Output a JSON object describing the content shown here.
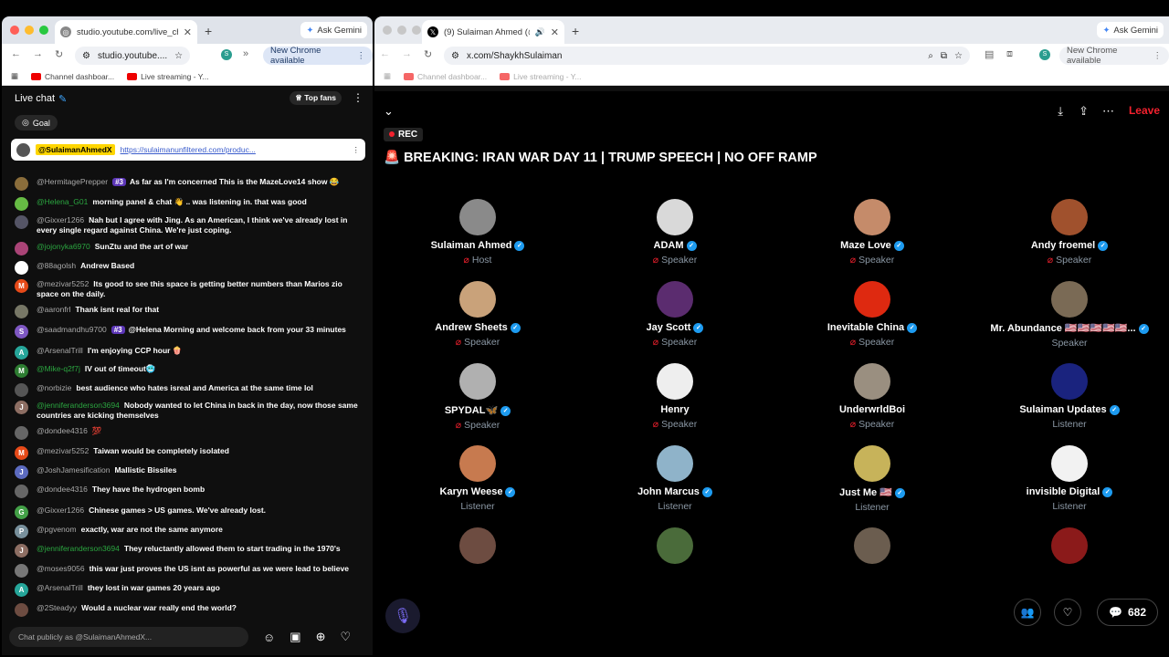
{
  "left_browser": {
    "tab_title": "studio.youtube.com/live_chat",
    "ask_gemini": "Ask Gemini",
    "url": "studio.youtube....",
    "new_chrome": "New Chrome available",
    "bookmarks": [
      "Channel dashboar...",
      "Live streaming - Y..."
    ]
  },
  "chat": {
    "title": "Live chat",
    "top_fans": "Top fans",
    "goal": "Goal",
    "pinned": {
      "author": "@SulaimanAhmedX",
      "link": "https://sulaimanunfiltered.com/produc..."
    },
    "messages": [
      {
        "author": "@HermitagePrepper",
        "badge": "#3",
        "text": "As far as I'm concerned This is the MazeLove14 show 😂",
        "color": "#8a6d3b"
      },
      {
        "author": "@Helena_G01",
        "text": "morning panel & chat 👋 .. was listening in. that was good",
        "color": "#6b4",
        "green": true
      },
      {
        "author": "@Gixxer1266",
        "text": "Nah but I agree with Jing. As an American, I think we've already lost in every single regard against China. We're just coping.",
        "color": "#556"
      },
      {
        "author": "@jojonyka6970",
        "text": "SunZtu and the art of war",
        "color": "#a47",
        "green": true
      },
      {
        "author": "@88agolsh",
        "text": "Andrew Based",
        "color": "#fff"
      },
      {
        "author": "@mezivar5252",
        "text": "Its good to see this space is getting better numbers than Marios zio space on the daily.",
        "color": "#e64a19",
        "initial": "M"
      },
      {
        "author": "@aaronfrl",
        "text": "Thank isnt real for that",
        "color": "#776"
      },
      {
        "author": "@saadmandhu9700",
        "badge": "#3",
        "text": "@Helena Morning and welcome back from your 33 minutes",
        "color": "#7e57c2",
        "initial": "S"
      },
      {
        "author": "@ArsenalTrill",
        "text": "I'm enjoying CCP hour 🍿",
        "color": "#26a69a",
        "initial": "A"
      },
      {
        "author": "@Mike-q2f7j",
        "text": "IV out of timeout🥶",
        "color": "#2e7d32",
        "initial": "M",
        "green": true
      },
      {
        "author": "@norbizie",
        "text": "best audience who hates isreal and America at the same time lol",
        "color": "#555"
      },
      {
        "author": "@jenniferanderson3694",
        "text": "Nobody wanted to let China in back in the day, now those same countries are kicking themselves",
        "color": "#8d6e63",
        "initial": "J",
        "green": true
      },
      {
        "author": "@dondee4316",
        "text": "💯",
        "color": "#666"
      },
      {
        "author": "@mezivar5252",
        "text": "Taiwan would be completely isolated",
        "color": "#e64a19",
        "initial": "M"
      },
      {
        "author": "@JoshJamesification",
        "text": "Mallistic Bissiles",
        "color": "#5c6bc0",
        "initial": "J"
      },
      {
        "author": "@dondee4316",
        "text": "They have the hydrogen bomb",
        "color": "#666"
      },
      {
        "author": "@Gixxer1266",
        "text": "Chinese games > US games. We've already lost.",
        "color": "#43a047",
        "initial": "G"
      },
      {
        "author": "@pgvenom",
        "text": "exactly, war are not the same anymore",
        "color": "#78909c",
        "initial": "P"
      },
      {
        "author": "@jenniferanderson3694",
        "text": "They reluctantly allowed them to start trading in the 1970's",
        "color": "#8d6e63",
        "initial": "J",
        "green": true
      },
      {
        "author": "@moses9056",
        "text": "this war just proves the US isnt as powerful as we were lead to believe",
        "color": "#777"
      },
      {
        "author": "@ArsenalTrill",
        "text": "they lost in war games 20 years ago",
        "color": "#26a69a",
        "initial": "A"
      },
      {
        "author": "@2Steadyy",
        "text": "Would a nuclear war really end the world?",
        "color": "#6d4c41"
      }
    ],
    "input_placeholder": "Chat publicly as @SulaimanAhmedX..."
  },
  "right_browser": {
    "tab_title": "(9) Sulaiman Ahmed (@Sh",
    "ask_gemini": "Ask Gemini",
    "url": "x.com/ShaykhSulaiman",
    "new_chrome": "New Chrome available",
    "bookmarks": [
      "Channel dashboar...",
      "Live streaming - Y..."
    ]
  },
  "space": {
    "rec": "REC",
    "title": "🚨 BREAKING: IRAN WAR DAY 11 | TRUMP SPEECH | NO OFF RAMP",
    "leave": "Leave",
    "listener_count": "682",
    "participants": [
      {
        "name": "Sulaiman Ahmed",
        "role": "Host",
        "verified": true,
        "mic": true,
        "color": "#8a8a8a"
      },
      {
        "name": "ADAM",
        "role": "Speaker",
        "verified": true,
        "mic": true,
        "color": "#d9d9d9"
      },
      {
        "name": "Maze Love",
        "role": "Speaker",
        "verified": true,
        "mic": true,
        "color": "#c58b6a"
      },
      {
        "name": "Andy froemel",
        "role": "Speaker",
        "verified": true,
        "mic": true,
        "color": "#a0512d"
      },
      {
        "name": "Andrew Sheets",
        "role": "Speaker",
        "verified": true,
        "mic": true,
        "color": "#c9a27a"
      },
      {
        "name": "Jay Scott",
        "role": "Speaker",
        "verified": true,
        "mic": true,
        "color": "#5b2c6f"
      },
      {
        "name": "Inevitable China",
        "role": "Speaker",
        "verified": true,
        "mic": true,
        "color": "#de2910"
      },
      {
        "name": "Mr. Abundance 🇺🇸🇺🇸🇺🇸🇺🇸🇺🇸...",
        "role": "Speaker",
        "verified": true,
        "mic": false,
        "color": "#7a6a55"
      },
      {
        "name": "SPYDAL🦋",
        "role": "Speaker",
        "verified": true,
        "mic": true,
        "color": "#b0b0b0"
      },
      {
        "name": "Henry",
        "role": "Speaker",
        "verified": false,
        "mic": true,
        "color": "#eeeeee"
      },
      {
        "name": "UnderwrldBoi",
        "role": "Speaker",
        "verified": false,
        "mic": true,
        "color": "#9a8f80"
      },
      {
        "name": "Sulaiman Updates",
        "role": "Listener",
        "verified": true,
        "mic": false,
        "color": "#1a237e"
      },
      {
        "name": "Karyn Weese",
        "role": "Listener",
        "verified": true,
        "mic": false,
        "color": "#c77a4f"
      },
      {
        "name": "John Marcus",
        "role": "Listener",
        "verified": true,
        "mic": false,
        "color": "#8fb3c9"
      },
      {
        "name": "Just Me 🇺🇸",
        "role": "Listener",
        "verified": true,
        "mic": false,
        "color": "#c7b35a"
      },
      {
        "name": "invisible Digital",
        "role": "Listener",
        "verified": true,
        "mic": false,
        "color": "#f2f2f2"
      },
      {
        "name": "",
        "role": "",
        "verified": false,
        "mic": false,
        "color": "#6d4c41"
      },
      {
        "name": "",
        "role": "",
        "verified": false,
        "mic": false,
        "color": "#4a6b3a"
      },
      {
        "name": "",
        "role": "",
        "verified": false,
        "mic": false,
        "color": "#6b5d4f"
      },
      {
        "name": "",
        "role": "",
        "verified": false,
        "mic": false,
        "color": "#8b1a1a"
      }
    ]
  }
}
